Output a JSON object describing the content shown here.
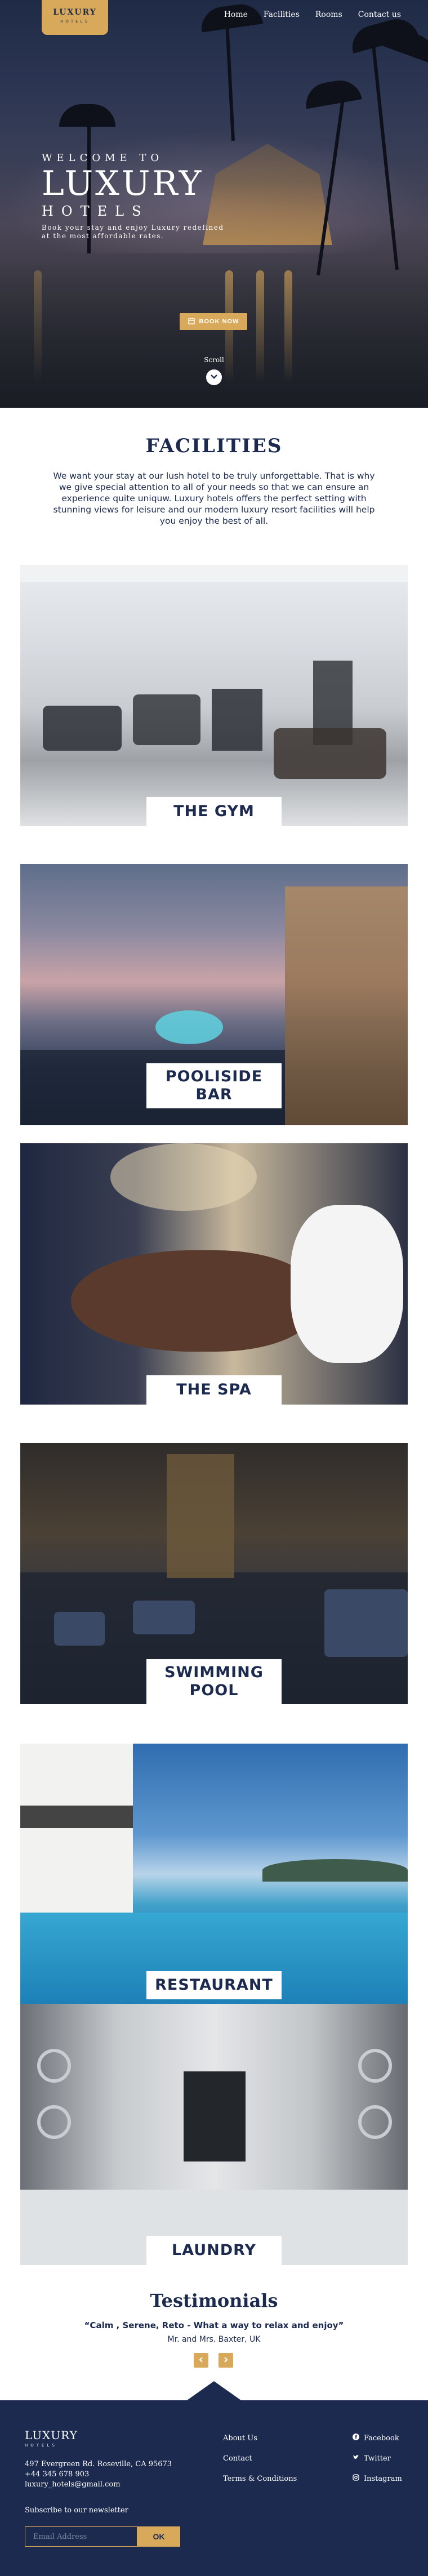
{
  "brand": {
    "logo_top": "LUXURY",
    "logo_bottom": "HOTELS"
  },
  "nav": {
    "items": [
      "Home",
      "Facilities",
      "Rooms",
      "Contact us"
    ]
  },
  "hero": {
    "welcome": "WELCOME TO",
    "title": "LUXURY",
    "subtitle": "HOTELS",
    "tagline": "Book your stay and enjoy Luxury redefined at the most affordable rates.",
    "book_button": "BOOK NOW",
    "scroll_label": "Scroll"
  },
  "facilities": {
    "title": "FACILITIES",
    "description": "We want your stay at our lush hotel to be truly unforgettable. That is why we give special attention to all of your needs so that we can ensure an experience quite uniquw. Luxury hotels offers the perfect setting with stunning views for leisure and our modern luxury resort facilities will help you enjoy the best of all.",
    "cards": [
      {
        "label": "THE GYM"
      },
      {
        "label": "POOLISIDE BAR"
      },
      {
        "label": "THE SPA"
      },
      {
        "label": "SWIMMING POOL"
      },
      {
        "label": "RESTAURANT"
      },
      {
        "label": "LAUNDRY"
      }
    ]
  },
  "testimonials": {
    "title": "Testimonials",
    "quote": "“Calm , Serene, Reto - What a way to relax and enjoy”",
    "author": "Mr. and Mrs. Baxter, UK",
    "prev_icon": "chevron-left-icon",
    "next_icon": "chevron-right-icon"
  },
  "footer": {
    "logo_top": "LUXURY",
    "logo_bottom": "HOTELS",
    "address": "497 Evergreen Rd. Roseville, CA 95673",
    "phone": "+44 345 678 903",
    "email": "luxury_hotels@gmail.com",
    "links": [
      "About Us",
      "Contact",
      "Terms & Conditions"
    ],
    "social": [
      "Facebook",
      "Twitter",
      "Instagram"
    ],
    "subscribe_label": "Subscribe to our newsletter",
    "email_placeholder": "Email Address",
    "ok_button": "OK"
  },
  "colors": {
    "navy": "#1b2a4e",
    "gold": "#d9a95b",
    "white": "#ffffff"
  }
}
